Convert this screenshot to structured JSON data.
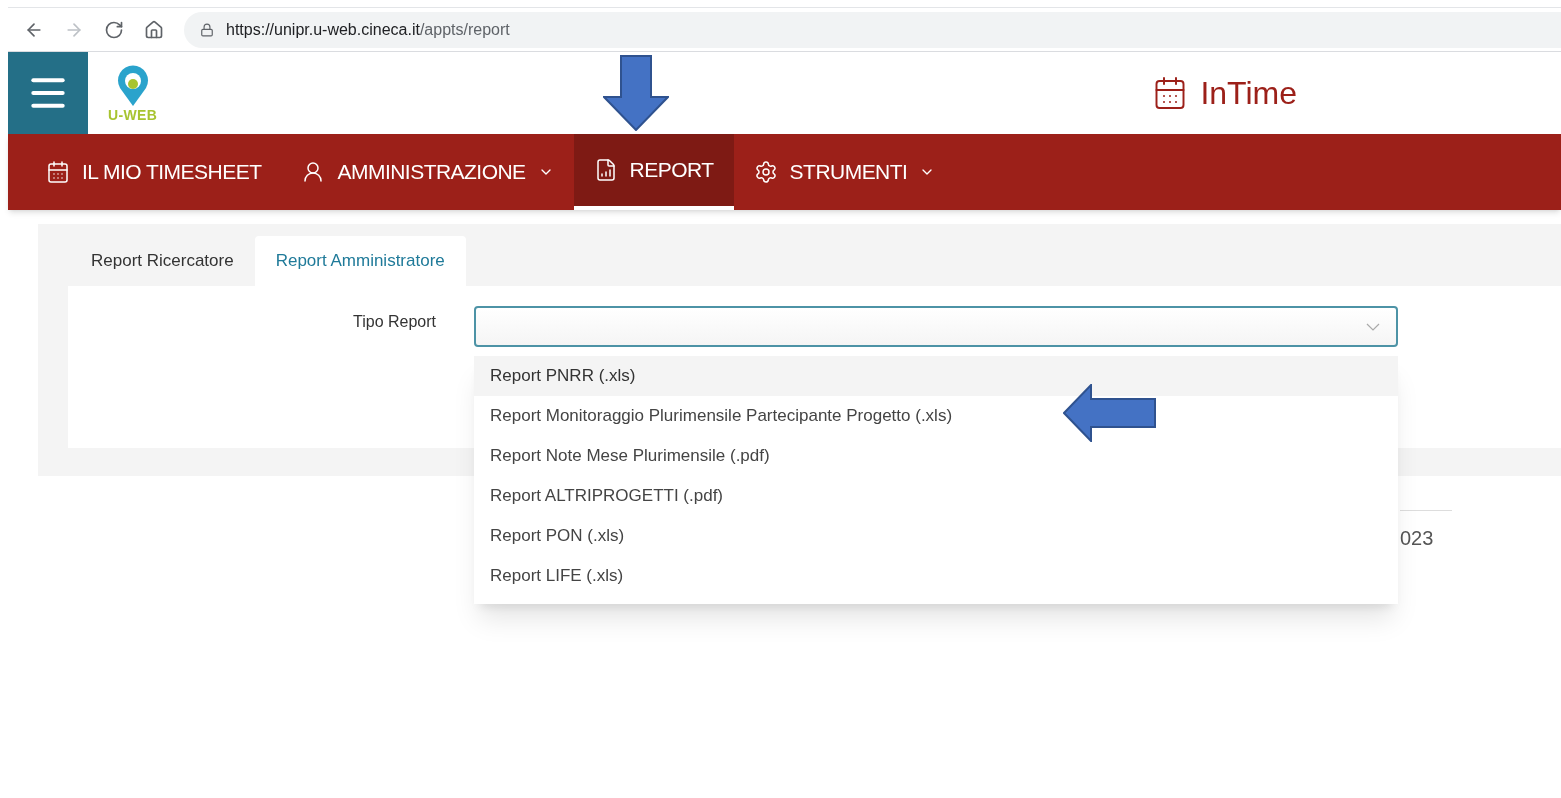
{
  "browser": {
    "url_host": "https://unipr.u-web.cineca.it",
    "url_path": "/appts/report"
  },
  "header": {
    "logo_text": "U-WEB",
    "app_title": "InTime"
  },
  "nav": [
    {
      "label": "IL MIO TIMESHEET",
      "kind": "calendar",
      "dropdown": false,
      "selected": false
    },
    {
      "label": "AMMINISTRAZIONE",
      "kind": "user",
      "dropdown": true,
      "selected": false
    },
    {
      "label": "REPORT",
      "kind": "report",
      "dropdown": false,
      "selected": true
    },
    {
      "label": "STRUMENTI",
      "kind": "gear",
      "dropdown": true,
      "selected": false
    }
  ],
  "tabs": [
    {
      "label": "Report Ricercatore",
      "selected": false
    },
    {
      "label": "Report Amministratore",
      "selected": true
    }
  ],
  "form": {
    "label": "Tipo Report",
    "options": [
      {
        "label": "Report PNRR (.xls)",
        "selected": true
      },
      {
        "label": "Report Monitoraggio Plurimensile Partecipante Progetto (.xls)",
        "selected": false
      },
      {
        "label": "Report Note Mese Plurimensile (.pdf)",
        "selected": false
      },
      {
        "label": "Report ALTRIPROGETTI (.pdf)",
        "selected": false
      },
      {
        "label": "Report PON (.xls)",
        "selected": false
      },
      {
        "label": "Report LIFE (.xls)",
        "selected": false
      }
    ]
  },
  "footer": {
    "text": "023"
  }
}
